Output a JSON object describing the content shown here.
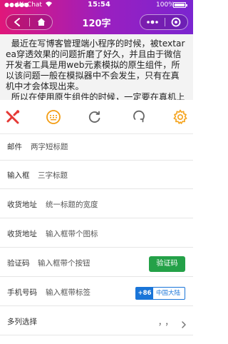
{
  "status_bar": {
    "signal": "●●●●●",
    "carrier": "WeChat",
    "time": "15:54",
    "battery_percent": "100%",
    "battery_level": 1.0
  },
  "nav": {
    "title": "120字"
  },
  "textarea": {
    "value": "  最近在写博客管理端小程序的时候，被textarea穿透效果的问题折磨了好久，并且由于微信开发者工具是用web元素模拟的原生组件，所以该问题一般在模拟器中不会发生，只有在真机中才会体现出来。\n  所以在使用原生组件的时候，一定要在真机上实际调"
  },
  "toolbar": {
    "icons": [
      "tools-icon",
      "keyboard-icon",
      "refresh-icon",
      "reload-icon",
      "gear-icon"
    ],
    "colors": {
      "red": "#e53935",
      "orange": "#f39c12",
      "gray": "#666666",
      "gold": "#f5a623"
    }
  },
  "form": {
    "rows": [
      {
        "label": "邮件",
        "value": "两字短标题"
      },
      {
        "label": "输入框",
        "value": "三字标题"
      },
      {
        "label": "收货地址",
        "value": "统一标题的宽度"
      },
      {
        "label": "收货地址",
        "value": "输入框带个图标"
      },
      {
        "label": "验证码",
        "value": "输入框带个按钮",
        "button": "验证码"
      },
      {
        "label": "手机号码",
        "value": "输入框带标签",
        "tag_code": "+86",
        "tag_name": "中国大陆"
      },
      {
        "label": "多列选择",
        "value": "，，"
      }
    ]
  }
}
